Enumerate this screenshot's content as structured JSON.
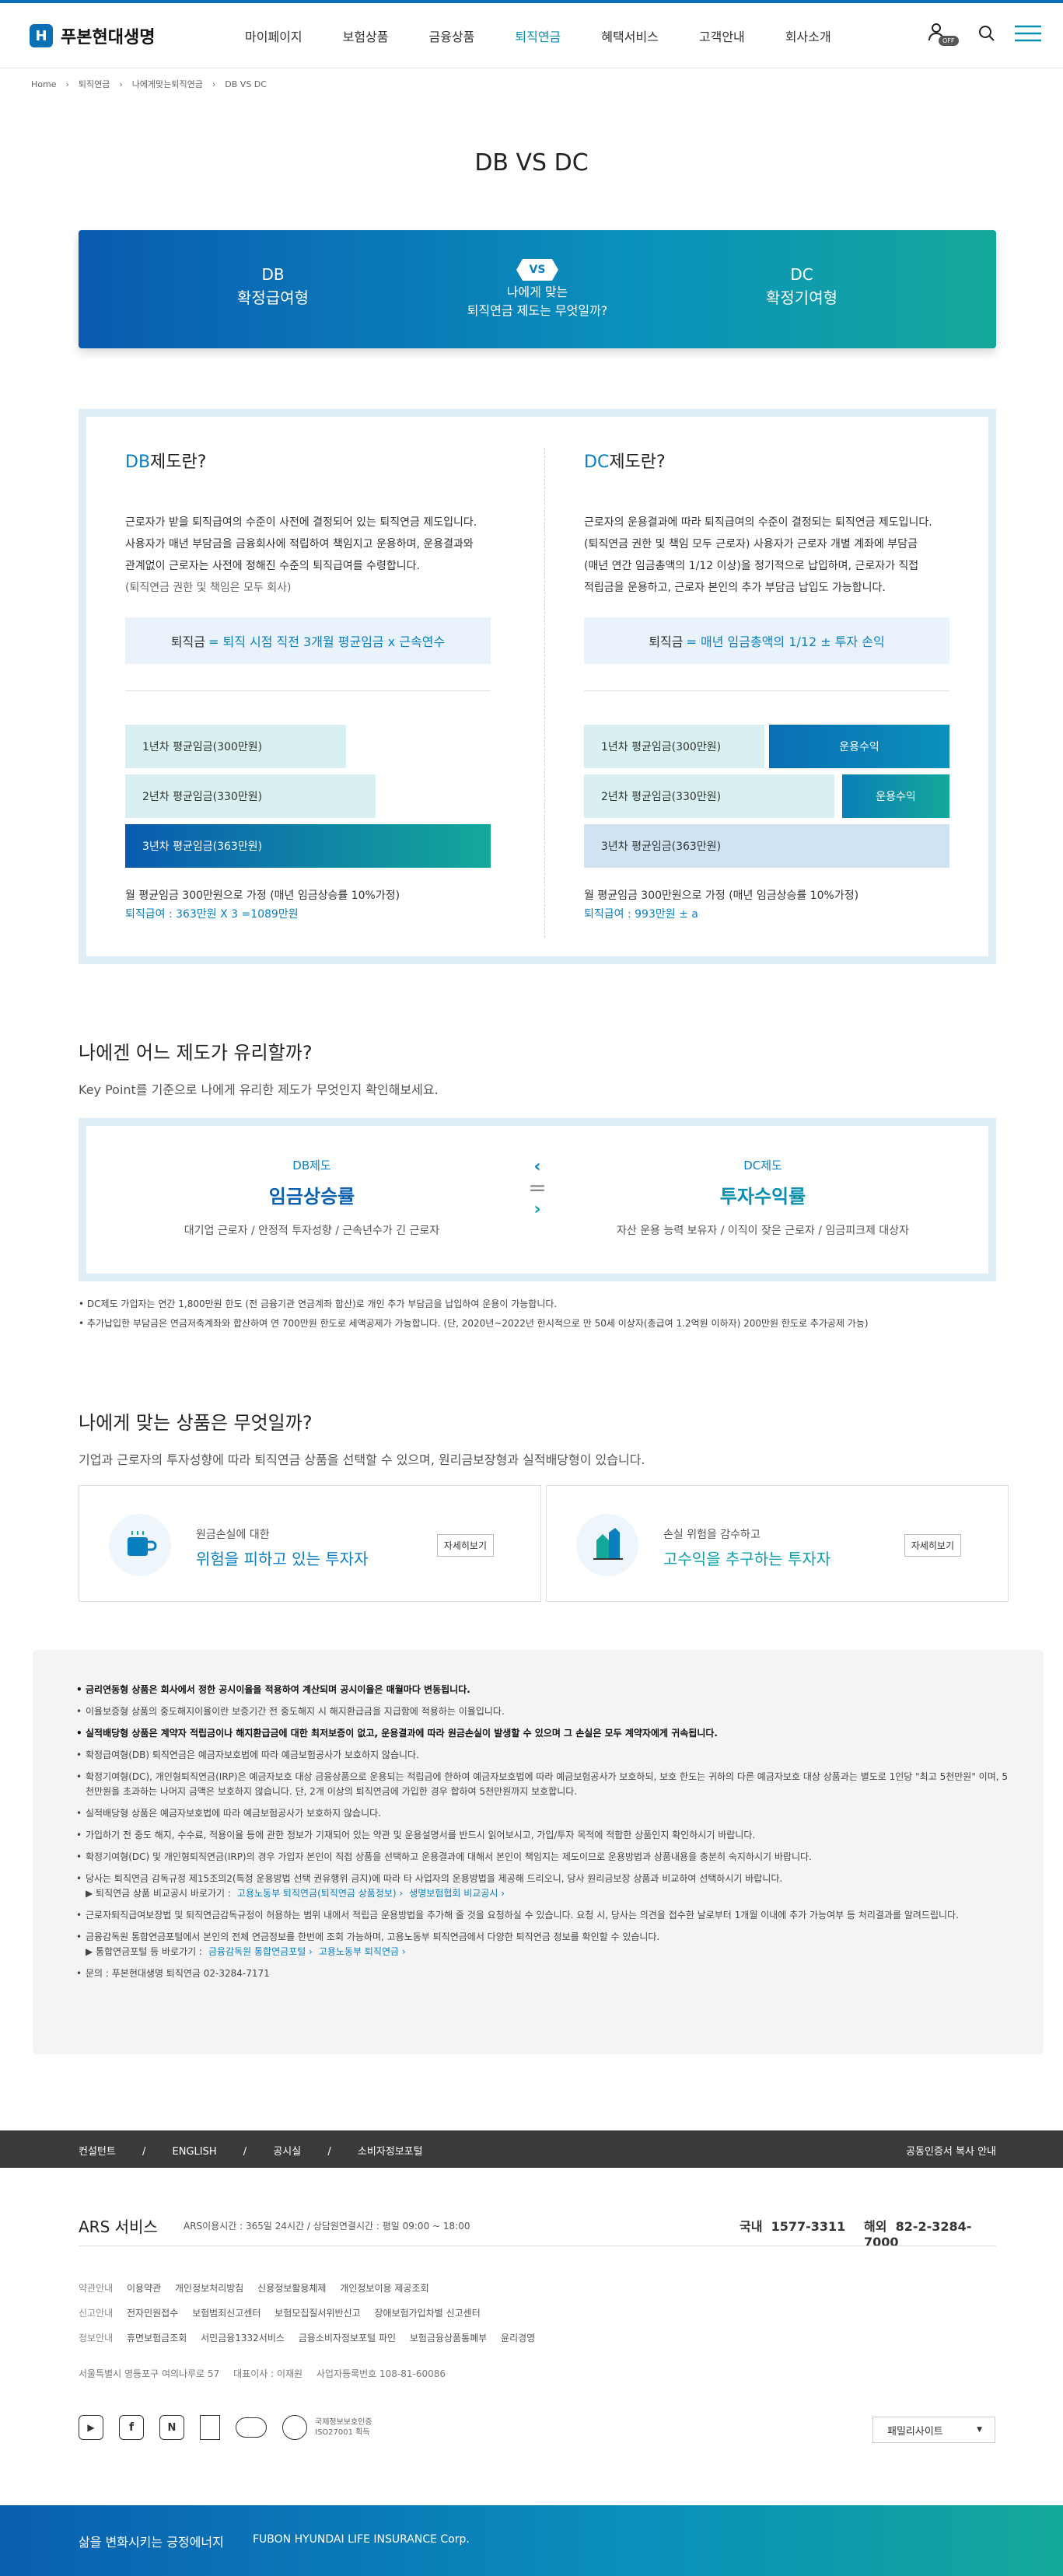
{
  "brand": {
    "name": "푸본현대생명"
  },
  "nav": [
    "마이페이지",
    "보험상품",
    "금융상품",
    "퇴직연금",
    "혜택서비스",
    "고객안내",
    "회사소개"
  ],
  "util": {
    "badge": "OFF"
  },
  "breadcrumb": [
    "Home",
    "퇴직연금",
    "나에게맞는퇴직연금",
    "DB VS DC"
  ],
  "page_title": "DB VS DC",
  "tabs": {
    "db_en": "DB",
    "db_kr": "확정급여형",
    "vs": "VS",
    "center1": "나에게 맞는",
    "center2": "퇴직연금 제도는 무엇일까?",
    "dc_en": "DC",
    "dc_kr": "확정기여형"
  },
  "db": {
    "title_a": "DB",
    "title_b": "제도란?",
    "desc": [
      "근로자가 받을 퇴직급여의 수준이 사전에 결정되어 있는 퇴직연금 제도입니다.",
      "사용자가 매년 부담금을 금융회사에 적립하여 책임지고 운용하며, 운용결과와",
      "관계없이 근로자는 사전에 정해진 수준의 퇴직급여를 수령합니다.",
      "(퇴직연금 권한 및 책임은 모두 회사)"
    ],
    "formula_a": "퇴직금",
    "formula_b": "= 퇴직 시점 직전 3개월 평균임금 x 근속연수",
    "bars": [
      "1년차 평균임금(300만원)",
      "2년차 평균임금(330만원)",
      "3년차 평균임금(363만원)"
    ],
    "note1": "월 평균임금 300만원으로 가정 (매년 임금상승률 10%가정)",
    "note2": "퇴직급여 : 363만원 X 3 =1089만원"
  },
  "dc": {
    "title_a": "DC",
    "title_b": "제도란?",
    "desc": [
      "근로자의 운용결과에 따라 퇴직급여의 수준이 결정되는 퇴직연금 제도입니다.",
      "(퇴직연금 권한 및 책임 모두 근로자) 사용자가 근로자 개별 계좌에 부담금",
      "(매년 연간 임금총액의 1/12 이상)을 정기적으로 납입하며, 근로자가 직접",
      "적립금을 운용하고, 근로자 본인의 추가 부담금 납입도 가능합니다."
    ],
    "formula_a": "퇴직금",
    "formula_b": "= 매년 임금총액의 1/12 ± 투자 손익",
    "bars": [
      "1년차 평균임금(300만원)",
      "2년차 평균임금(330만원)",
      "3년차 평균임금(363만원)"
    ],
    "ret": [
      "운용수익",
      "운용수익"
    ],
    "note1": "월 평균임금 300만원으로 가정 (매년 임금상승률 10%가정)",
    "note2": "퇴직급여 : 993만원 ± a"
  },
  "keypoint": {
    "title": "나에겐 어느 제도가 유리할까?",
    "sub": "Key Point를 기준으로 나에게 유리한 제도가 무엇인지 확인해보세요.",
    "left_t": "DB제도",
    "left_h": "임금상승률",
    "left_d": "대기업 근로자 / 안정적 투자성향 / 근속년수가 긴 근로자",
    "eq": "=",
    "right_t": "DC제도",
    "right_h": "투자수익률",
    "right_d": "자산 운용 능력 보유자 / 이직이 잦은 근로자 / 임금피크제 대상자",
    "bullets": [
      "DC제도 가입자는 연간 1,800만원 한도 (전 금융기관 연금계좌 합산)로 개인 추가 부담금을 납입하여 운용이 가능합니다.",
      "추가납입한 부담금은 연금저축계좌와 합산하여 연 700만원 한도로 세액공제가 가능합니다. (단, 2020년~2022년 한시적으로 만 50세 이상자(총급여 1.2억원 이하자) 200만원 한도로 추가공제 가능)"
    ]
  },
  "products": {
    "title": "나에게 맞는 상품은 무엇일까?",
    "sub": "기업과 근로자의 투자성향에 따라 퇴직연금 상품을 선택할 수 있으며, 원리금보장형과 실적배당형이 있습니다.",
    "items": [
      {
        "s1": "원금손실에 대한",
        "s2": "위험을 피하고 있는 투자자",
        "btn": "자세히보기",
        "icon": "coffee-cup-icon"
      },
      {
        "s1": "손실 위험을 감수하고",
        "s2": "고수익을 추구하는 투자자",
        "btn": "자세히보기",
        "icon": "building-chart-icon"
      }
    ]
  },
  "notices": [
    {
      "t": "금리연동형 상품은 회사에서 정한 공시이율을 적용하여 계산되며 공시이율은 매월마다 변동됩니다.",
      "bold": true
    },
    {
      "t": "이율보증형 상품의 중도해지이율이란 보증기간 전 중도해지 시 해지환급금을 지급함에 적용하는 이율입니다.",
      "bold": false
    },
    {
      "t": "실적배당형 상품은 계약자 적립금이나 해지환급금에 대한 최저보증이 없고, 운용결과에 따라 원금손실이 발생할 수 있으며 그 손실은 모두 계약자에게 귀속됩니다.",
      "bold": true
    },
    {
      "t": "확정급여형(DB) 퇴직연금은 예금자보호법에 따라 예금보험공사가 보호하지 않습니다.",
      "bold": false
    },
    {
      "t": "확정기여형(DC), 개인형퇴직연금(IRP)은 예금자보호 대상 금융상품으로 운용되는 적립금에 한하여 예금자보호법에 따라 예금보험공사가 보호하되, 보호 한도는 귀하의 다른 예금자보호 대상 상품과는 별도로 1인당 \"최고 5천만원\" 이며, 5천만원을 초과하는 나머지 금액은 보호하지 않습니다. 단, 2개 이상의 퇴직연금에 가입한 경우 합하여 5천만원까지 보호합니다.",
      "bold": false
    },
    {
      "t": "실적배당형 상품은 예금자보호법에 따라 예금보험공사가 보호하지 않습니다.",
      "bold": false
    },
    {
      "t": "가입하기 전 중도 해지, 수수료, 적용이율 등에 관한 정보가 기재되어 있는 약관 및 운용설명서를 반드시 읽어보시고, 가입/투자 목적에 적합한 상품인지 확인하시기 바랍니다.",
      "bold": false
    },
    {
      "t": "확정기여형(DC) 및 개인형퇴직연금(IRP)의 경우 가입자 본인이 직접 상품을 선택하고 운용결과에 대해서 본인이 책임지는 제도이므로 운용방법과 상품내용을 충분히 숙지하시기 바랍니다.",
      "bold": false
    },
    {
      "t": "당사는 퇴직연금 감독규정 제15조의2(특정 운용방법 선택 권유행위 금지)에 따라 타 사업자의 운용방법을 제공해 드리오니, 당사 원리금보장 상품과 비교하여 선택하시기 바랍니다.",
      "bold": false,
      "link_pre": "▶ 퇴직연금 상품 비교공시 바로가기 :",
      "links": [
        "고용노동부 퇴직연금(퇴직연금 상품정보) ›",
        "생명보험협회 비교공시 ›"
      ]
    },
    {
      "t": "근로자퇴직급여보장법 및 퇴직연금감독규정이 허용하는 범위 내에서 적립금 운용방법을 추가해 줄 것을 요청하실 수 있습니다. 요청 시, 당사는 의견을 접수한 날로부터 1개월 이내에 추가 가능여부 등 처리결과를 알려드립니다.",
      "bold": false
    },
    {
      "t": "금융감독원 통합연금포털에서 본인의 전체 연금정보를 한번에 조회 가능하며, 고용노동부 퇴직연금에서 다양한 퇴직연금 정보를 확인할 수 있습니다.",
      "bold": false,
      "link_pre": "▶ 통합연금포털 등 바로가기 :",
      "links": [
        "금융감독원 통합연금포털 ›",
        "고용노동부 퇴직연금 ›"
      ]
    },
    {
      "t": "문의 : 푸본현대생명 퇴직연금 02-3284-7171",
      "bold": false
    }
  ],
  "footer": {
    "top_links": [
      "컨설턴트",
      "ENGLISH",
      "공시실",
      "소비자정보포털"
    ],
    "top_right": "공동인증서 복사 안내",
    "ars_title": "ARS 서비스",
    "ars_desc": "ARS이용시간 : 365일 24시간 / 상담원연결시간 : 평일 09:00 ~ 18:00",
    "domestic_label": "국내",
    "domestic_num": "1577-3311",
    "overseas_label": "해외",
    "overseas_num": "82-2-3284-7000",
    "rows": [
      {
        "label": "약관안내",
        "items": [
          "이용약관",
          "개인정보처리방침",
          "신용정보활용체제",
          "개인정보이용 제공조회"
        ]
      },
      {
        "label": "신고안내",
        "items": [
          "전자민원접수",
          "보험범죄신고센터",
          "보험모집질서위반신고",
          "장애보험가입차별 신고센터"
        ]
      },
      {
        "label": "정보안내",
        "items": [
          "휴면보험금조회",
          "서민금융1332서비스",
          "금융소비자정보포털 파인",
          "보험금융상품통폐부",
          "윤리경영"
        ]
      }
    ],
    "address": "서울특별시 영등포구 여의나루로 57",
    "ceo": "대표이사 : 이재원",
    "bizno": "사업자등록번호 108-81-60086",
    "cert": [
      "국제정보보호인증",
      "ISO27001 획득"
    ],
    "family": "패밀리사이트",
    "slogan": "삶을 변화시키는 긍정에너지",
    "corp": "FUBON HYUNDAI LIFE INSURANCE Corp."
  },
  "colors": {
    "primary": "#0a7fc0",
    "teal": "#14a89a",
    "dark": "#3a3a3a"
  }
}
